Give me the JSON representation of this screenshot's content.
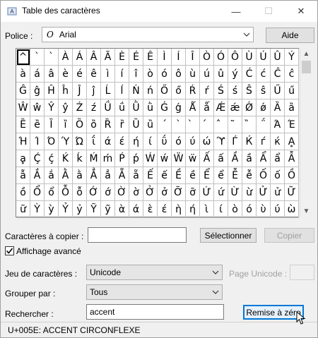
{
  "window": {
    "title": "Table des caractères",
    "minimize": "—",
    "maximize": "☐",
    "close": "✕"
  },
  "font": {
    "label": "Police :",
    "value": "Arial",
    "icon_glyph": "O",
    "help_label": "Aide"
  },
  "grid": {
    "rows": [
      [
        "^",
        "`",
        "`",
        "À",
        "Á",
        "Â",
        "Ã",
        "È",
        "É",
        "Ê",
        "Ì",
        "Í",
        "Î",
        "Ò",
        "Ó",
        "Ô",
        "Ù",
        "Ú",
        "Û",
        "Ý"
      ],
      [
        "à",
        "á",
        "â",
        "è",
        "é",
        "ê",
        "ì",
        "í",
        "î",
        "ò",
        "ó",
        "ô",
        "ù",
        "ú",
        "û",
        "ý",
        "Ć",
        "ć",
        "Ĉ",
        "ĉ"
      ],
      [
        "Ĝ",
        "ĝ",
        "Ĥ",
        "ĥ",
        "Ĵ",
        "ĵ",
        "Ĺ",
        "ĺ",
        "Ń",
        "ń",
        "Ő",
        "ő",
        "Ŕ",
        "ŕ",
        "Ś",
        "ś",
        "Ŝ",
        "ŝ",
        "Ű",
        "ű"
      ],
      [
        "Ŵ",
        "ŵ",
        "Ŷ",
        "ŷ",
        "Ź",
        "ź",
        "Ǘ",
        "ǘ",
        "Ǜ",
        "ǜ",
        "Ǵ",
        "ǵ",
        "Ǻ",
        "ǻ",
        "Ǽ",
        "ǽ",
        "Ǿ",
        "ǿ",
        "Ȁ",
        "ȁ"
      ],
      [
        "Ȅ",
        "ȅ",
        "Ȉ",
        "ȉ",
        "Ȍ",
        "ȍ",
        "Ȑ",
        "ȑ",
        "Ȕ",
        "ȕ",
        "ˊ",
        "ˋ",
        "̀",
        "́",
        "̂",
        "̃",
        "̏",
        "΅",
        "Ά",
        "Έ"
      ],
      [
        "Ή",
        "Ί",
        "Ό",
        "Ύ",
        "Ώ",
        "ΐ",
        "ά",
        "έ",
        "ή",
        "ί",
        "ΰ",
        "ό",
        "ύ",
        "ώ",
        "ϓ",
        "Ѓ",
        "Ќ",
        "ѓ",
        "ќ",
        "Ḁ"
      ],
      [
        "ḁ",
        "Ḉ",
        "ḉ",
        "Ḱ",
        "ḱ",
        "Ḿ",
        "ḿ",
        "Ṕ",
        "ṕ",
        "Ẃ",
        "ẃ",
        "Ẅ",
        "ẅ",
        "Ấ",
        "ấ",
        "Ầ",
        "ầ",
        "Ẩ",
        "ẩ",
        "Ẫ"
      ],
      [
        "ẫ",
        "Ắ",
        "ắ",
        "Ằ",
        "ằ",
        "Ẳ",
        "ẳ",
        "Ẵ",
        "ẵ",
        "Ế",
        "ế",
        "Ề",
        "ề",
        "Ể",
        "ể",
        "Ễ",
        "ễ",
        "Ố",
        "ố",
        "Ồ"
      ],
      [
        "ồ",
        "Ổ",
        "ổ",
        "Ỗ",
        "ỗ",
        "Ớ",
        "ớ",
        "Ờ",
        "ờ",
        "Ở",
        "ở",
        "Ỡ",
        "ỡ",
        "Ứ",
        "ứ",
        "Ừ",
        "ừ",
        "Ử",
        "ử",
        "Ữ"
      ],
      [
        "ữ",
        "Ỳ",
        "ỳ",
        "Ỷ",
        "ỷ",
        "Ỹ",
        "ỹ",
        "ὰ",
        "ά",
        "ὲ",
        "έ",
        "ὴ",
        "ή",
        "ὶ",
        "ί",
        "ὸ",
        "ό",
        "ὺ",
        "ύ",
        "ὼ"
      ]
    ]
  },
  "copy": {
    "label": "Caractères à copier :",
    "value": "",
    "select_label": "Sélectionner",
    "copy_label": "Copier"
  },
  "advanced": {
    "label": "Affichage avancé",
    "checked": true
  },
  "charset": {
    "label": "Jeu de caractères :",
    "value": "Unicode",
    "page_label": "Page Unicode :",
    "page_value": ""
  },
  "group": {
    "label": "Grouper par :",
    "value": "Tous"
  },
  "search": {
    "label": "Rechercher :",
    "value": "accent",
    "reset_label": "Remise à zéro"
  },
  "status": {
    "text": "U+005E: ACCENT CIRCONFLEXE"
  }
}
